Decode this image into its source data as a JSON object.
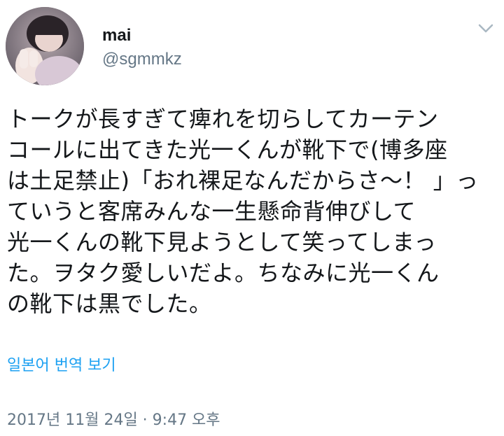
{
  "user": {
    "display_name": "mai",
    "handle": "@sgmmkz",
    "avatar_icon": "user-avatar-photo"
  },
  "menu": {
    "icon": "chevron-down-icon"
  },
  "tweet": {
    "lines": [
      "トークが長すぎて痺れを切らしてカーテン",
      "コールに出てきた光一くんが靴下で(博多座",
      "は土足禁止)「おれ裸足なんだからさ〜！ 」っ",
      "ていうと客席みんな一生懸命背伸びして",
      "光一くんの靴下見ようとして笑ってしまっ",
      "た。ヲタク愛しいだよ。ちなみに光一くん",
      "の靴下は黒でした。"
    ]
  },
  "translate_label": "일본어 번역 보기",
  "timestamp": "2017년 11월 24일 · 9:47 오후",
  "colors": {
    "link": "#1da1f2",
    "secondary": "#657786",
    "text": "#14171a"
  }
}
